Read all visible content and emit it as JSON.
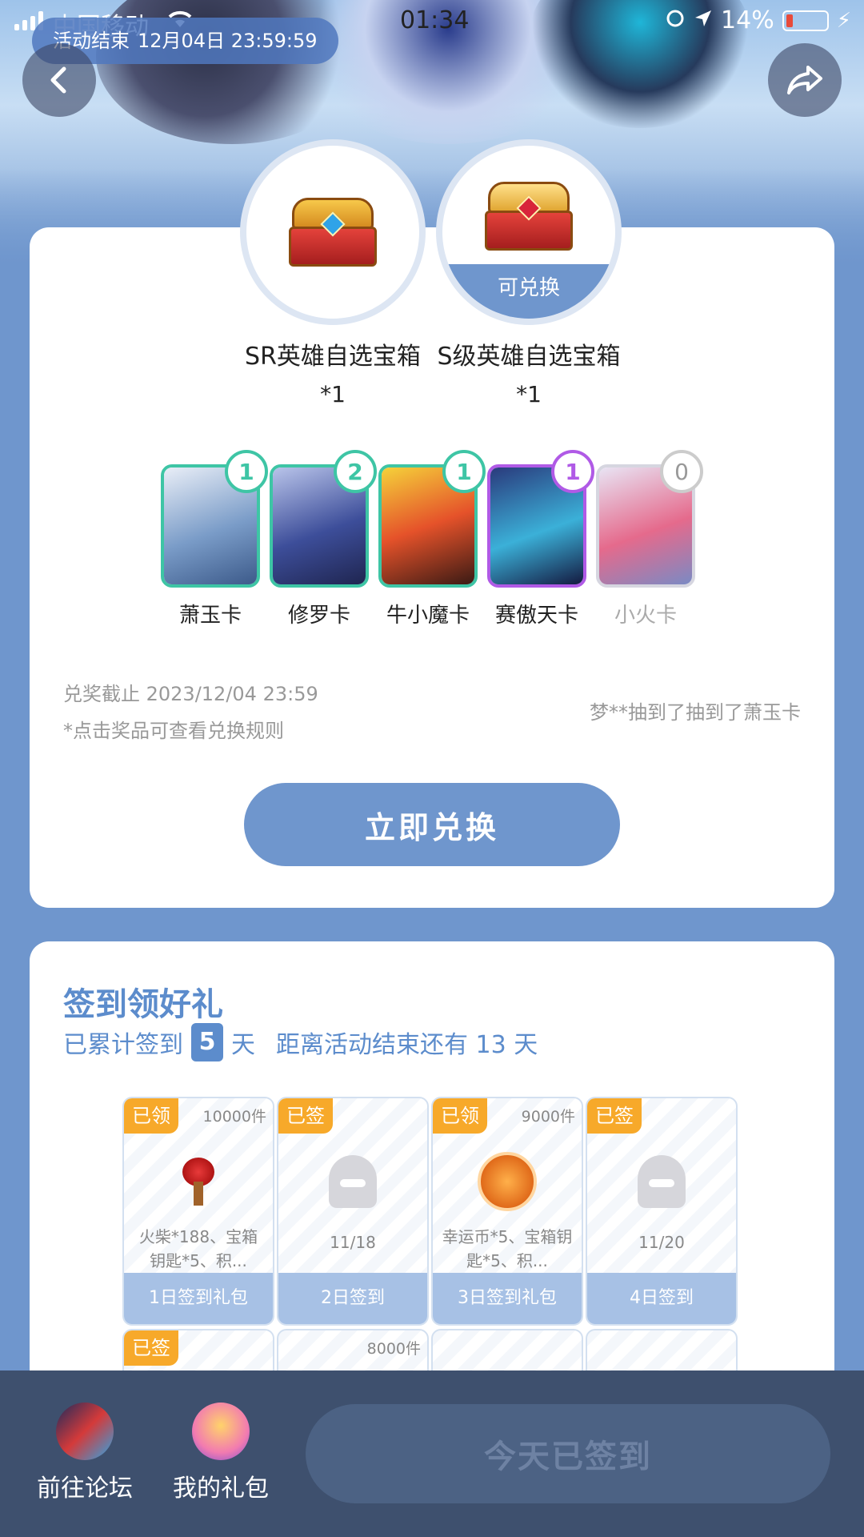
{
  "status_bar": {
    "carrier": "中国移动",
    "time": "01:34",
    "battery": "14%"
  },
  "header": {
    "end_label": "活动结束",
    "end_time": "12月04日 23:59:59"
  },
  "prizes": [
    {
      "name": "SR英雄自选宝箱",
      "count": "*1",
      "badge": ""
    },
    {
      "name": "S级英雄自选宝箱",
      "count": "*1",
      "badge": "可兑换"
    }
  ],
  "heroes": [
    {
      "name": "萧玉卡",
      "count": "1"
    },
    {
      "name": "修罗卡",
      "count": "2"
    },
    {
      "name": "牛小魔卡",
      "count": "1"
    },
    {
      "name": "赛傲天卡",
      "count": "1"
    },
    {
      "name": "小火卡",
      "count": "0"
    }
  ],
  "exchange": {
    "deadline": "兑奖截止 2023/12/04 23:59",
    "rule_hint": "*点击奖品可查看兑换规则",
    "winner_text": "梦**抽到了抽到了萧玉卡",
    "redeem_label": "立即兑换"
  },
  "checkin": {
    "title": "签到领好礼",
    "sub_prefix": "已累计签到",
    "days": "5",
    "sub_unit": "天",
    "remaining": "距离活动结束还有 13 天",
    "cells": [
      {
        "tag": "已领",
        "stock": "10000件",
        "desc": "火柴*188、宝箱钥匙*5、积...",
        "foot": "1日签到礼包"
      },
      {
        "tag": "已签",
        "stock": "",
        "date": "11/18",
        "foot": "2日签到"
      },
      {
        "tag": "已领",
        "stock": "9000件",
        "desc": "幸运币*5、宝箱钥匙*5、积...",
        "foot": "3日签到礼包"
      },
      {
        "tag": "已签",
        "stock": "",
        "date": "11/20",
        "foot": "4日签到"
      },
      {
        "tag": "已签",
        "stock": ""
      },
      {
        "tag": "",
        "stock": "8000件"
      },
      {
        "tag": "",
        "stock": ""
      },
      {
        "tag": "",
        "stock": ""
      }
    ]
  },
  "bottom": {
    "forum_label": "前往论坛",
    "gift_label": "我的礼包",
    "signed_label": "今天已签到"
  }
}
